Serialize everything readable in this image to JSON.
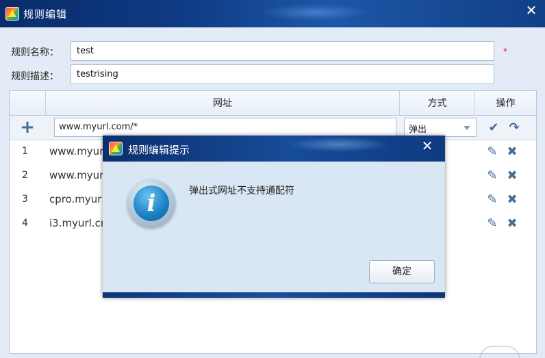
{
  "window": {
    "title": "规则编辑",
    "close_glyph": "✕"
  },
  "form": {
    "name_label": "规则名称：",
    "name_value": "test",
    "required_mark": "*",
    "desc_label": "规则描述：",
    "desc_value": "testrising"
  },
  "table": {
    "headers": {
      "url": "网址",
      "mode": "方式",
      "ops": "操作"
    },
    "edit_row": {
      "add_glyph": "+",
      "url_value": "www.myurl.com/*",
      "mode_value": "弹出",
      "confirm_glyph": "✔",
      "redo_glyph": "↷"
    },
    "rows": [
      {
        "num": "1",
        "url": "www.myurl"
      },
      {
        "num": "2",
        "url": "www.myurl"
      },
      {
        "num": "3",
        "url": "cpro.myur"
      },
      {
        "num": "4",
        "url": "i3.myurl.cn"
      }
    ],
    "row_edit_glyph": "✎",
    "row_delete_glyph": "✖"
  },
  "dialog": {
    "title": "规则编辑提示",
    "close_glyph": "✕",
    "icon_glyph": "i",
    "message": "弹出式网址不支持通配符",
    "ok_label": "确定"
  },
  "colors": {
    "titlebar": "#0f3c86",
    "body_bg": "#e3ecf6",
    "icon_blue": "#4a6d96",
    "required": "#e02020"
  }
}
